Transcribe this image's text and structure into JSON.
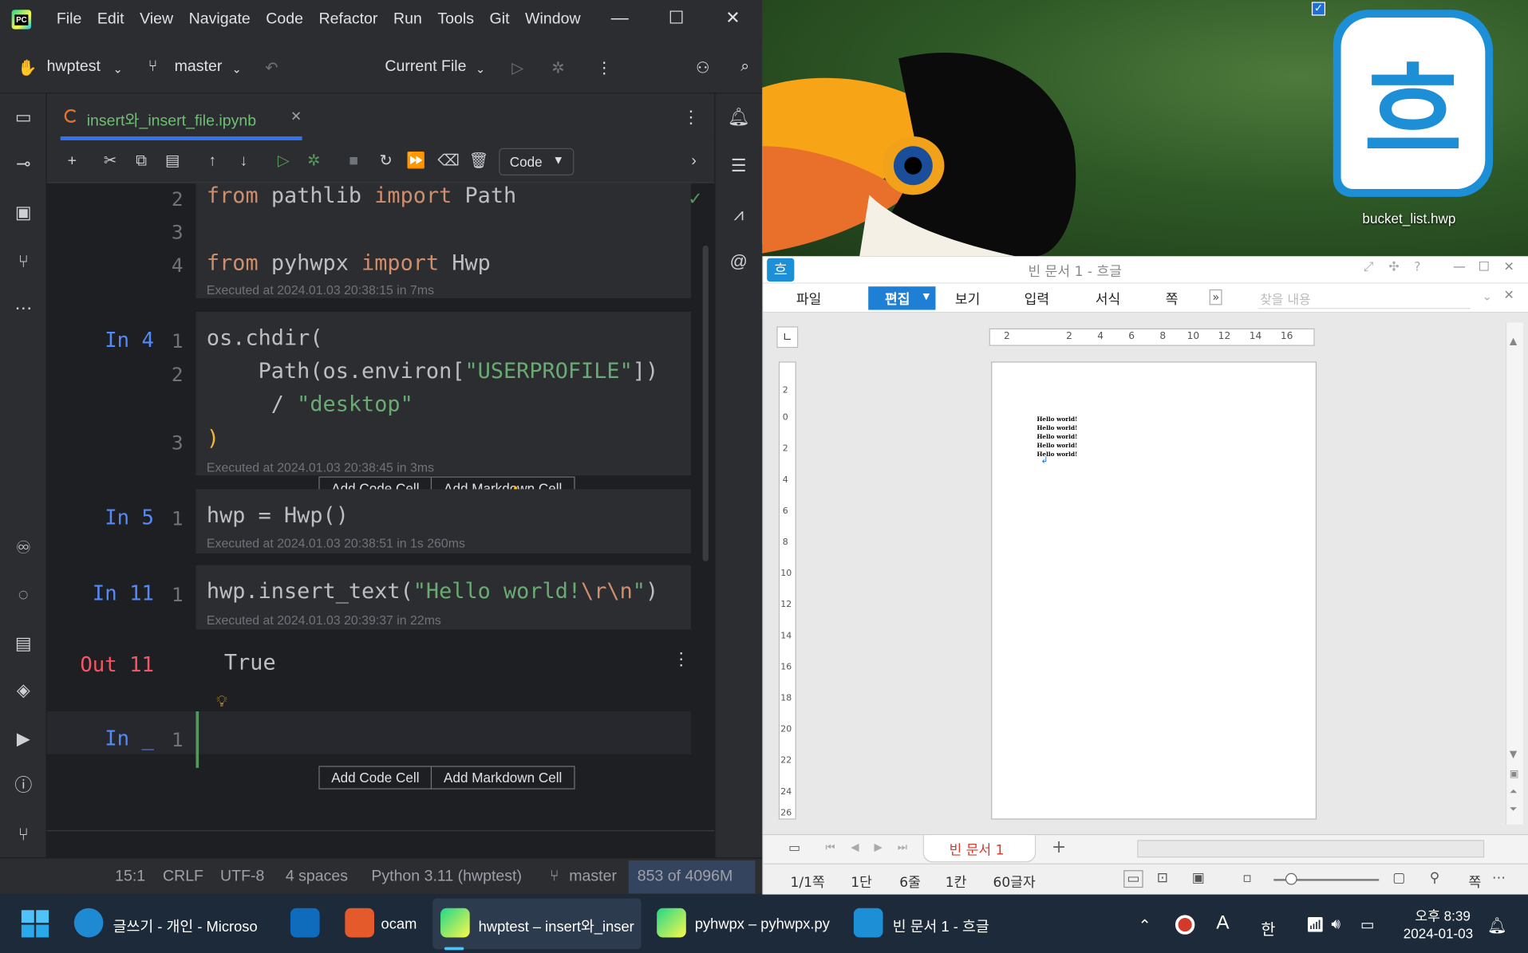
{
  "ide": {
    "menu": [
      "File",
      "Edit",
      "View",
      "Navigate",
      "Code",
      "Refactor",
      "Run",
      "Tools",
      "Git",
      "Window"
    ],
    "project": "hwptest",
    "branch": "master",
    "run_config": "Current File",
    "tab_name": "insert와_insert_file.ipynb",
    "cell_type": "Code",
    "cells": [
      {
        "prompt": "",
        "lines": [
          "2",
          "3",
          "4"
        ],
        "exec": "Executed at 2024.01.03 20:38:15 in 7ms"
      },
      {
        "prompt": "In 4",
        "lines": [
          "1",
          "2",
          "",
          "3"
        ],
        "exec": "Executed at 2024.01.03 20:38:45 in 3ms"
      },
      {
        "prompt": "In 5",
        "lines": [
          "1"
        ],
        "exec": "Executed at 2024.01.03 20:38:51 in 1s 260ms"
      },
      {
        "prompt": "In 11",
        "lines": [
          "1"
        ],
        "exec": "Executed at 2024.01.03 20:39:37 in 22ms"
      }
    ],
    "code": {
      "c1_kw1": "from",
      "c1_mod1": " pathlib ",
      "c1_kw2": "import",
      "c1_name1": " Path",
      "c1_kw3": "from",
      "c1_mod2": " pyhwpx ",
      "c1_kw4": "import",
      "c1_name2": " Hwp",
      "c2_l1": "os.chdir(",
      "c2_l2a": "    Path(os.environ[",
      "c2_l2s": "\"USERPROFILE\"",
      "c2_l2b": "])",
      "c2_l3a": "     / ",
      "c2_l3s": "\"desktop\"",
      "c2_l4": ")",
      "c3": "hwp = Hwp()",
      "c4a": "hwp.insert_text(",
      "c4s": "\"Hello world!",
      "c4e": "\\r\\n",
      "c4q": "\"",
      "c4b": ")"
    },
    "out_prompt": "Out 11",
    "out_value": "True",
    "empty_prompt": "In _",
    "empty_line": "1",
    "add_code": "Add Code Cell",
    "add_md": "Add Markdown Cell",
    "status": {
      "pos": "15:1",
      "eol": "CRLF",
      "enc": "UTF-8",
      "indent": "4 spaces",
      "interp": "Python 3.11 (hwptest)",
      "branch": "master",
      "mem": "853 of 4096M"
    }
  },
  "desktop": {
    "icon_label": "bucket_list.hwp",
    "icon_glyph": "흐"
  },
  "hwp": {
    "title": "빈 문서 1 - 흐글",
    "app_glyph": "흐",
    "menus": [
      "파일",
      "편집",
      "보기",
      "입력",
      "서식",
      "쪽"
    ],
    "search_placeholder": "찾을 내용",
    "ruler": [
      "2",
      "2",
      "4",
      "6",
      "8",
      "10",
      "12",
      "14",
      "16"
    ],
    "vruler": [
      "2",
      "0",
      "2",
      "4",
      "6",
      "8",
      "10",
      "12",
      "14",
      "16",
      "18",
      "20",
      "22",
      "24",
      "26"
    ],
    "page_lines": [
      "Hello world!",
      "Hello world!",
      "Hello world!",
      "Hello world!",
      "Hello world!"
    ],
    "doc_tab": "빈 문서 1",
    "status": [
      "1/1쪽",
      "1단",
      "6줄",
      "1칸",
      "60글자"
    ],
    "status_right": "쪽"
  },
  "taskbar": {
    "items": [
      {
        "label": "글쓰기 - 개인 - Microso",
        "color": "#1f8ad1"
      },
      {
        "label": "",
        "color": "#0f6cbd"
      },
      {
        "label": "ocam",
        "color": "#e45a2b"
      },
      {
        "label": "hwptest – insert와_inser",
        "color": "#21d789"
      },
      {
        "label": "pyhwpx – pyhwpx.py",
        "color": "#21d789"
      },
      {
        "label": "빈 문서 1 - 흐글",
        "color": "#1d8fd6"
      }
    ],
    "time": "오후 8:39",
    "date": "2024-01-03",
    "ime": "A",
    "ime2": "한"
  }
}
